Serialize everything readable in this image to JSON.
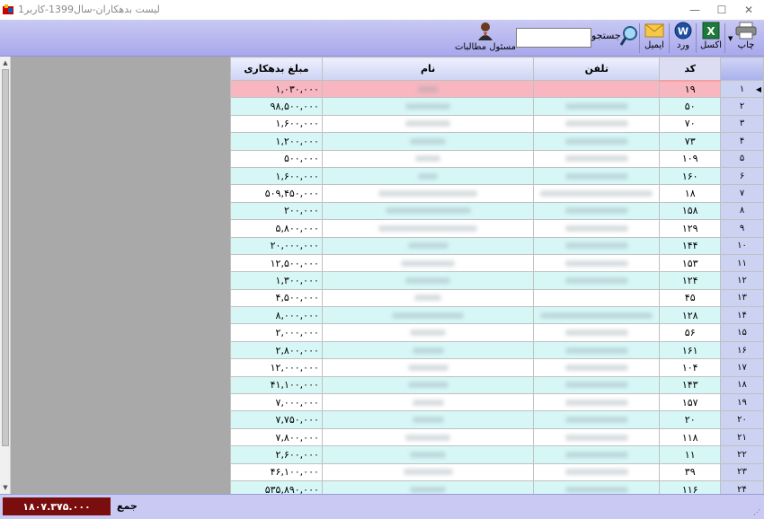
{
  "window": {
    "title": "لیست بدهکاران-سال1399-کاربر1",
    "minimize": "—",
    "maximize": "☐",
    "close": "✕"
  },
  "toolbar": {
    "print_label": "چاپ",
    "excel_label": "اکسل",
    "word_label": "ورد",
    "email_label": "ایمیل",
    "search_label": "جستجو",
    "search_value": "",
    "user_label": "مسئول مطالبات"
  },
  "columns": {
    "code": "کد",
    "phone": "تلفن",
    "name": "نام",
    "amount": "مبلغ بدهکاری"
  },
  "rows": [
    {
      "num": "۱",
      "code": "۱۹",
      "amount": "۱,۰۳۰,۰۰۰",
      "name_w": 22,
      "phone_w": 0
    },
    {
      "num": "۲",
      "code": "۵۰",
      "amount": "۹۸,۵۰۰,۰۰۰",
      "name_w": 50,
      "phone_w": 70
    },
    {
      "num": "۳",
      "code": "۷۰",
      "amount": "۱,۶۰۰,۰۰۰",
      "name_w": 50,
      "phone_w": 70
    },
    {
      "num": "۴",
      "code": "۷۳",
      "amount": "۱,۲۰۰,۰۰۰",
      "name_w": 40,
      "phone_w": 70
    },
    {
      "num": "۵",
      "code": "۱۰۹",
      "amount": "۵۰۰,۰۰۰",
      "name_w": 28,
      "phone_w": 70
    },
    {
      "num": "۶",
      "code": "۱۶۰",
      "amount": "۱,۶۰۰,۰۰۰",
      "name_w": 22,
      "phone_w": 70
    },
    {
      "num": "۷",
      "code": "۱۸",
      "amount": "۵۰۹,۴۵۰,۰۰۰",
      "name_w": 110,
      "phone_w": 125
    },
    {
      "num": "۸",
      "code": "۱۵۸",
      "amount": "۲۰۰,۰۰۰",
      "name_w": 95,
      "phone_w": 70
    },
    {
      "num": "۹",
      "code": "۱۲۹",
      "amount": "۵,۸۰۰,۰۰۰",
      "name_w": 110,
      "phone_w": 70
    },
    {
      "num": "۱۰",
      "code": "۱۴۴",
      "amount": "۲۰,۰۰۰,۰۰۰",
      "name_w": 45,
      "phone_w": 70
    },
    {
      "num": "۱۱",
      "code": "۱۵۳",
      "amount": "۱۲,۵۰۰,۰۰۰",
      "name_w": 60,
      "phone_w": 70
    },
    {
      "num": "۱۲",
      "code": "۱۲۴",
      "amount": "۱,۳۰۰,۰۰۰",
      "name_w": 50,
      "phone_w": 70
    },
    {
      "num": "۱۳",
      "code": "۴۵",
      "amount": "۴,۵۰۰,۰۰۰",
      "name_w": 30,
      "phone_w": 0
    },
    {
      "num": "۱۴",
      "code": "۱۲۸",
      "amount": "۸,۰۰۰,۰۰۰",
      "name_w": 80,
      "phone_w": 125
    },
    {
      "num": "۱۵",
      "code": "۵۶",
      "amount": "۲,۰۰۰,۰۰۰",
      "name_w": 40,
      "phone_w": 70
    },
    {
      "num": "۱۶",
      "code": "۱۶۱",
      "amount": "۲,۸۰۰,۰۰۰",
      "name_w": 35,
      "phone_w": 70
    },
    {
      "num": "۱۷",
      "code": "۱۰۴",
      "amount": "۱۲,۰۰۰,۰۰۰",
      "name_w": 45,
      "phone_w": 70
    },
    {
      "num": "۱۸",
      "code": "۱۴۳",
      "amount": "۴۱,۱۰۰,۰۰۰",
      "name_w": 45,
      "phone_w": 70
    },
    {
      "num": "۱۹",
      "code": "۱۵۷",
      "amount": "۷,۰۰۰,۰۰۰",
      "name_w": 35,
      "phone_w": 70
    },
    {
      "num": "۲۰",
      "code": "۲۰",
      "amount": "۷,۷۵۰,۰۰۰",
      "name_w": 35,
      "phone_w": 70
    },
    {
      "num": "۲۱",
      "code": "۱۱۸",
      "amount": "۷,۸۰۰,۰۰۰",
      "name_w": 50,
      "phone_w": 70
    },
    {
      "num": "۲۲",
      "code": "۱۱",
      "amount": "۲,۶۰۰,۰۰۰",
      "name_w": 40,
      "phone_w": 70
    },
    {
      "num": "۲۳",
      "code": "۳۹",
      "amount": "۴۶,۱۰۰,۰۰۰",
      "name_w": 55,
      "phone_w": 70
    },
    {
      "num": "۲۴",
      "code": "۱۱۶",
      "amount": "۵۳۵,۸۹۰,۰۰۰",
      "name_w": 40,
      "phone_w": 70
    }
  ],
  "footer": {
    "total_value": "۱۸۰۷.۳۷۵.۰۰۰",
    "total_label": "جمع"
  },
  "colors": {
    "toolbar_bg": "#c9c9f4",
    "selected_row": "#f7b6c0",
    "alt_row": "#d7f7f7",
    "total_box": "#7a0e0e"
  }
}
